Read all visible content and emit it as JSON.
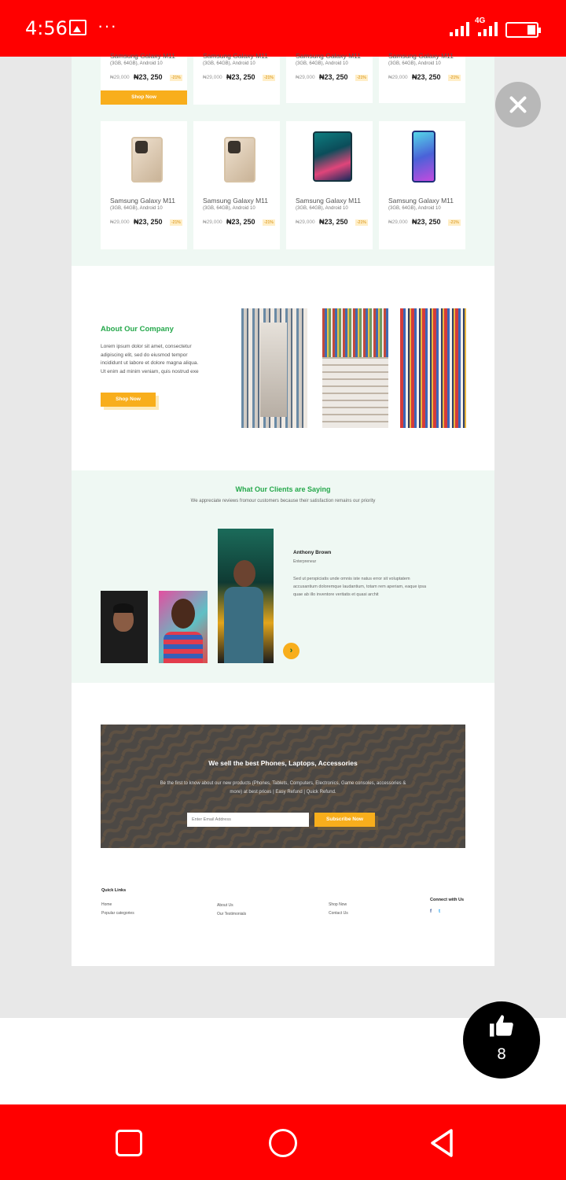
{
  "status_bar": {
    "time": "4:56",
    "more": "···",
    "network": "4G"
  },
  "products": {
    "card_name": "Samsung Galaxy M11",
    "card_spec": "(3GB, 64GB), Android 10",
    "old_price": "₦29,000",
    "new_price": "₦23, 250",
    "discount": "-21%",
    "shop_now": "Shop Now"
  },
  "about": {
    "title": "About Our Company",
    "text": "Lorem ipsum dolor sit amet, consectetur adipiscing elit, sed do eiusmod tempor incididunt ut labore et dolore magna aliqua. Ut enim ad minim veniam, quis nostrud exe",
    "button": "Shop Now"
  },
  "testimonials": {
    "title": "What Our Clients are Saying",
    "subtitle": "We appreciate reviews fromour customers because their satisfaction remains our priority",
    "name": "Anthony Brown",
    "role": "Enterpreneur",
    "quote": "Sed ut perspiciatis unde omnis iste natus error sit voluptatem accusantium doloremque laudantium, totam rem aperiam, eaque ipsa quae ab illo inventore veritatis et quasi archit",
    "next_icon": "›"
  },
  "newsletter": {
    "heading": "We sell the best Phones, Laptops, Accessories",
    "text": "Be the first to know about our new products (Phones, Tablets, Computers, Electronics, Game consoles, accessories & more) at best prices | Easy Refund | Quick Refund.",
    "placeholder": "Enter Email Address",
    "button": "Subscribe Now"
  },
  "footer": {
    "quick_links": "Quick Links",
    "links_col1": [
      "Home",
      "Popular categories"
    ],
    "links_col2": [
      "About Us",
      "Our Testimonials"
    ],
    "links_col3": [
      "Shop Now",
      "Contact Us"
    ],
    "connect": "Connect with Us",
    "facebook": "f",
    "twitter": "t"
  },
  "like": {
    "count": "8"
  },
  "colors": {
    "status_bar": "#ff0000",
    "accent_green": "#25a84b",
    "accent_yellow": "#f8ae1c"
  }
}
